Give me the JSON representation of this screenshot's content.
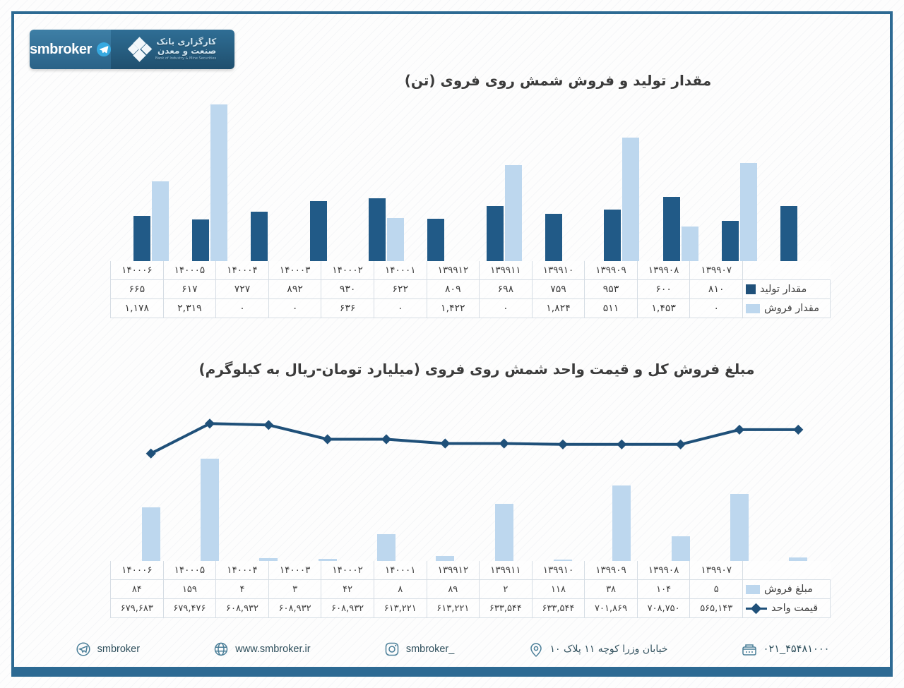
{
  "brand": {
    "bank_line1": "کارگزاری بانک",
    "bank_line2": "صنعت و معدن",
    "bank_en": "Bank of Industry & Mine Securities",
    "wordmark": "smbroker",
    "telegram_icon": "telegram-icon",
    "logo_icon": "diamond-logo-icon"
  },
  "charts": [
    {
      "title": "مقدار تولید و فروش شمش روی فروی (تن)"
    },
    {
      "title": "مبلغ فروش کل و قیمت واحد شمش روی فروی (میلیارد تومان-ریال به کیلوگرم)"
    }
  ],
  "table1": {
    "periods": [
      "۱۳۹۹۰۷",
      "۱۳۹۹۰۸",
      "۱۳۹۹۰۹",
      "۱۳۹۹۱۰",
      "۱۳۹۹۱۱",
      "۱۳۹۹۱۲",
      "۱۴۰۰۰۱",
      "۱۴۰۰۰۲",
      "۱۴۰۰۰۳",
      "۱۴۰۰۰۴",
      "۱۴۰۰۰۵",
      "۱۴۰۰۰۶"
    ],
    "rows": [
      {
        "label": "مقدار تولید",
        "legend": "sq-dark",
        "values": [
          "۸۱۰",
          "۶۰۰",
          "۹۵۳",
          "۷۵۹",
          "۶۹۸",
          "۸۰۹",
          "۶۲۲",
          "۹۳۰",
          "۸۹۲",
          "۷۲۷",
          "۶۱۷",
          "۶۶۵"
        ]
      },
      {
        "label": "مقدار فروش",
        "legend": "sq-light",
        "values": [
          "۰",
          "۱,۴۵۳",
          "۵۱۱",
          "۱,۸۲۴",
          "۰",
          "۱,۴۲۲",
          "۰",
          "۶۳۶",
          "۰",
          "۰",
          "۲,۳۱۹",
          "۱,۱۷۸"
        ]
      }
    ]
  },
  "table2": {
    "periods": [
      "۱۳۹۹۰۷",
      "۱۳۹۹۰۸",
      "۱۳۹۹۰۹",
      "۱۳۹۹۱۰",
      "۱۳۹۹۱۱",
      "۱۳۹۹۱۲",
      "۱۴۰۰۰۱",
      "۱۴۰۰۰۲",
      "۱۴۰۰۰۳",
      "۱۴۰۰۰۴",
      "۱۴۰۰۰۵",
      "۱۴۰۰۰۶"
    ],
    "rows": [
      {
        "label": "مبلغ فروش",
        "legend": "sq-light",
        "values": [
          "۵",
          "۱۰۴",
          "۳۸",
          "۱۱۸",
          "۲",
          "۸۹",
          "۸",
          "۴۲",
          "۳",
          "۴",
          "۱۵۹",
          "۸۴"
        ]
      },
      {
        "label": "قیمت واحد",
        "legend": "line-mark",
        "values": [
          "۵۶۵,۱۴۳",
          "۷۰۸,۷۵۰",
          "۷۰۱,۸۶۹",
          "۶۳۳,۵۴۴",
          "۶۳۳,۵۴۴",
          "۶۱۳,۲۲۱",
          "۶۱۳,۲۲۱",
          "۶۰۸,۹۳۲",
          "۶۰۸,۹۳۲",
          "۶۰۸,۹۳۲",
          "۶۷۹,۴۷۶",
          "۶۷۹,۶۸۳"
        ]
      }
    ]
  },
  "colors": {
    "production_bar": "#215a87",
    "sales_bar": "#bdd7ee",
    "line": "#1f5079",
    "frame": "#2d6a93",
    "title_text": "#3b3b3b"
  },
  "footer": {
    "items": [
      {
        "text": "۰۲۱_۴۵۴۸۱۰۰۰",
        "icon": "phone-icon",
        "ltr": true
      },
      {
        "text": "خیابان وزرا کوچه ۱۱ پلاک ۱۰",
        "icon": "location-pin-icon",
        "ltr": false
      },
      {
        "text": "smbroker_",
        "icon": "instagram-icon",
        "ltr": true
      },
      {
        "text": "www.smbroker.ir",
        "icon": "globe-icon",
        "ltr": true
      },
      {
        "text": "smbroker",
        "icon": "telegram-plane-icon",
        "ltr": true
      }
    ]
  },
  "chart_data": [
    {
      "type": "bar",
      "title": "مقدار تولید و فروش شمش روی فروی (تن)",
      "xlabel": "",
      "ylabel": "تن",
      "grid": false,
      "legend_position": "table-below",
      "categories": [
        "۱۳۹۹۰۷",
        "۱۳۹۹۰۸",
        "۱۳۹۹۰۹",
        "۱۳۹۹۱۰",
        "۱۳۹۹۱۱",
        "۱۳۹۹۱۲",
        "۱۴۰۰۰۱",
        "۱۴۰۰۰۲",
        "۱۴۰۰۰۳",
        "۱۴۰۰۰۴",
        "۱۴۰۰۰۵",
        "۱۴۰۰۰۶"
      ],
      "ylim": [
        0,
        2400
      ],
      "series": [
        {
          "name": "مقدار تولید",
          "color": "#215a87",
          "values": [
            810,
            600,
            953,
            759,
            698,
            809,
            622,
            930,
            892,
            727,
            617,
            665
          ]
        },
        {
          "name": "مقدار فروش",
          "color": "#bdd7ee",
          "values": [
            0,
            1453,
            511,
            1824,
            0,
            1422,
            0,
            636,
            0,
            0,
            2319,
            1178
          ]
        }
      ]
    },
    {
      "type": "bar+line",
      "title": "مبلغ فروش کل و قیمت واحد شمش روی فروی (میلیارد تومان-ریال به کیلوگرم)",
      "xlabel": "",
      "ylabel": "میلیارد تومان / ریال به کیلوگرم",
      "grid": false,
      "legend_position": "table-below",
      "categories": [
        "۱۳۹۹۰۷",
        "۱۳۹۹۰۸",
        "۱۳۹۹۰۹",
        "۱۳۹۹۱۰",
        "۱۳۹۹۱۱",
        "۱۳۹۹۱۲",
        "۱۴۰۰۰۱",
        "۱۴۰۰۰۲",
        "۱۴۰۰۰۳",
        "۱۴۰۰۰۴",
        "۱۴۰۰۰۵",
        "۱۴۰۰۰۶"
      ],
      "ylim_bar": [
        0,
        170
      ],
      "ylim_line": [
        500000,
        730000
      ],
      "series": [
        {
          "name": "مبلغ فروش",
          "type": "bar",
          "color": "#bdd7ee",
          "values": [
            5,
            104,
            38,
            118,
            2,
            89,
            8,
            42,
            3,
            4,
            159,
            84
          ]
        },
        {
          "name": "قیمت واحد",
          "type": "line",
          "color": "#1f5079",
          "marker": "diamond",
          "values": [
            565143,
            708750,
            701869,
            633544,
            633544,
            613221,
            613221,
            608932,
            608932,
            608932,
            679476,
            679683
          ]
        }
      ]
    }
  ]
}
